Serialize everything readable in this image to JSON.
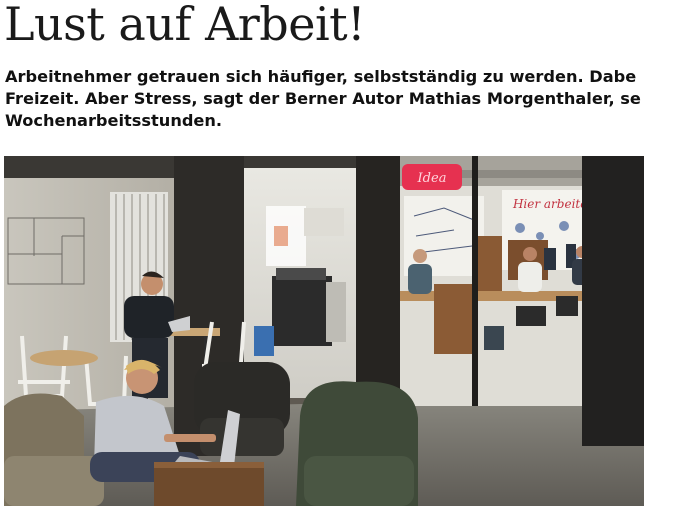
{
  "article": {
    "headline": "Lust auf Arbeit!",
    "lead_lines": [
      "Arbeitnehmer getrauen sich häufiger, selbstständig zu werden. Dabe",
      "Freizeit. Aber Stress, sagt der Berner Autor Mathias Morgenthaler, se",
      "Wochenarbeitsstunden."
    ]
  },
  "photo": {
    "wall_lettering": "Hier arbeiten",
    "neon_sign": "Idea"
  }
}
